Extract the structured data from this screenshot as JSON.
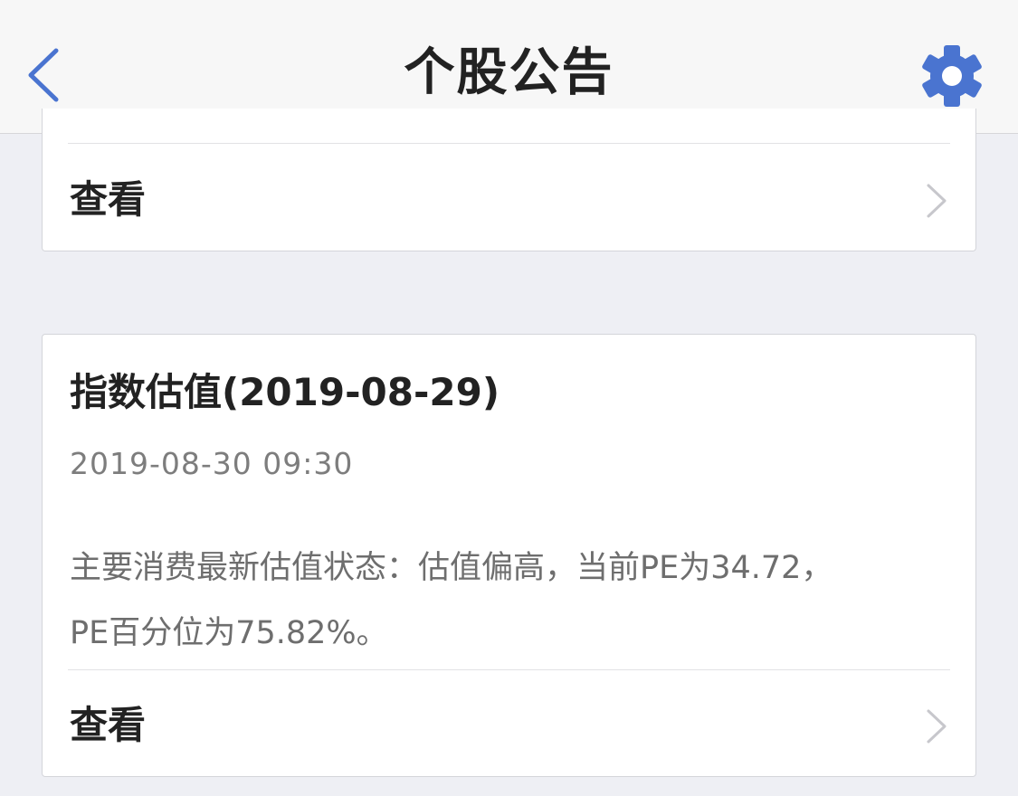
{
  "nav": {
    "title": "个股公告",
    "back_icon": "chevron-left-icon",
    "settings_icon": "gear-icon",
    "accent_color": "#4a74d0"
  },
  "cards": [
    {
      "action_label": "查看"
    },
    {
      "title": "指数估值(2019-08-29)",
      "date": "2019-08-30 09:30",
      "body_lines": [
        "主要消费最新估值状态：估值偏高，当前PE为34.72，",
        "PE百分位为75.82%。"
      ],
      "action_label": "查看"
    }
  ]
}
